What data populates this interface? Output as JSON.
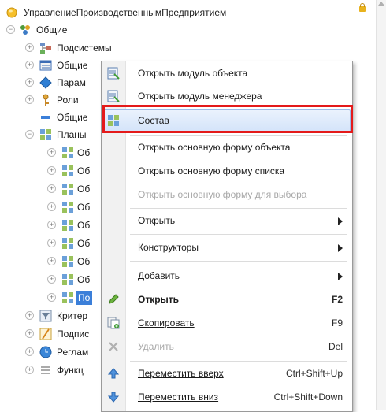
{
  "tree": {
    "root": {
      "label": "УправлениеПроизводственнымПредприятием"
    },
    "common": {
      "label": "Общие"
    },
    "items": [
      {
        "label": "Подсистемы"
      },
      {
        "label": "Общие"
      },
      {
        "label": "Парам"
      },
      {
        "label": "Роли"
      },
      {
        "label": "Общие"
      },
      {
        "label": "Планы"
      },
      {
        "label": "Об"
      },
      {
        "label": "Об"
      },
      {
        "label": "Об"
      },
      {
        "label": "Об"
      },
      {
        "label": "Об"
      },
      {
        "label": "Об"
      },
      {
        "label": "Об"
      },
      {
        "label": "Об"
      },
      {
        "label": "По"
      },
      {
        "label": "Критер"
      },
      {
        "label": "Подпис"
      },
      {
        "label": "Реглам"
      },
      {
        "label": "Функц"
      }
    ]
  },
  "menu": {
    "items": [
      {
        "label": "Открыть модуль объекта",
        "icon": "module-icon"
      },
      {
        "label": "Открыть модуль менеджера",
        "icon": "module-icon"
      },
      {
        "label": "Состав",
        "icon": "composition-icon",
        "highlighted": true
      },
      {
        "label": "Открыть основную форму объекта"
      },
      {
        "label": "Открыть основную форму списка"
      },
      {
        "label": "Открыть основную форму для выбора",
        "disabled": true
      },
      {
        "label": "Открыть",
        "submenu": true
      },
      {
        "label": "Конструкторы",
        "submenu": true
      },
      {
        "label": "Добавить",
        "submenu": true
      },
      {
        "label": "Открыть",
        "shortcut": "F2",
        "bold": true,
        "icon": "pencil-icon"
      },
      {
        "label": "Скопировать",
        "shortcut": "F9",
        "icon": "copy-icon"
      },
      {
        "label": "Удалить",
        "shortcut": "Del",
        "disabled": true,
        "icon": "delete-icon"
      },
      {
        "label": "Переместить вверх",
        "shortcut": "Ctrl+Shift+Up",
        "icon": "arrow-up-icon"
      },
      {
        "label": "Переместить вниз",
        "shortcut": "Ctrl+Shift+Down",
        "icon": "arrow-down-icon"
      }
    ]
  },
  "colors": {
    "highlight_box": "#e41a1a",
    "accent_blue": "#3b7fd9"
  }
}
